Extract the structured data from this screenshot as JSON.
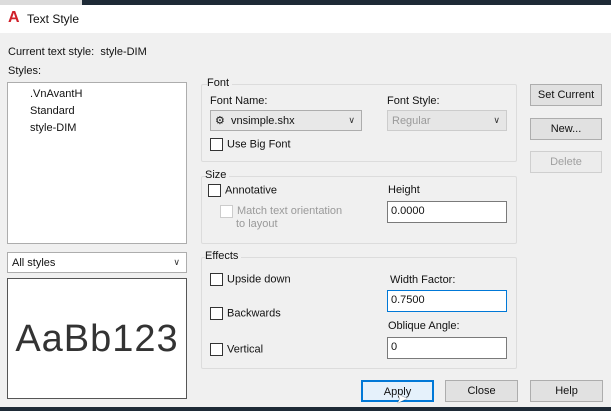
{
  "window": {
    "title": "Text Style",
    "icon": "autocad-logo-icon"
  },
  "current_style": {
    "label": "Current text style:",
    "value": "style-DIM"
  },
  "styles": {
    "label": "Styles:",
    "items": [
      ".VnAvantH",
      "Standard",
      "style-DIM"
    ],
    "filter": "All styles",
    "preview": "AaBb123"
  },
  "font": {
    "group": "Font",
    "font_name_label": "Font Name:",
    "font_name": "vnsimple.shx",
    "font_style_label": "Font Style:",
    "font_style": "Regular",
    "use_big_font": "Use Big Font"
  },
  "size": {
    "group": "Size",
    "annotative": "Annotative",
    "match": "Match text orientation to layout",
    "height_label": "Height",
    "height": "0.0000"
  },
  "effects": {
    "group": "Effects",
    "upside_down": "Upside down",
    "backwards": "Backwards",
    "vertical": "Vertical",
    "width_factor_label": "Width Factor:",
    "width_factor": "0.7500",
    "oblique_label": "Oblique Angle:",
    "oblique": "0"
  },
  "buttons": {
    "set_current": "Set Current",
    "new": "New...",
    "delete": "Delete",
    "apply": "Apply",
    "close": "Close",
    "help": "Help"
  }
}
